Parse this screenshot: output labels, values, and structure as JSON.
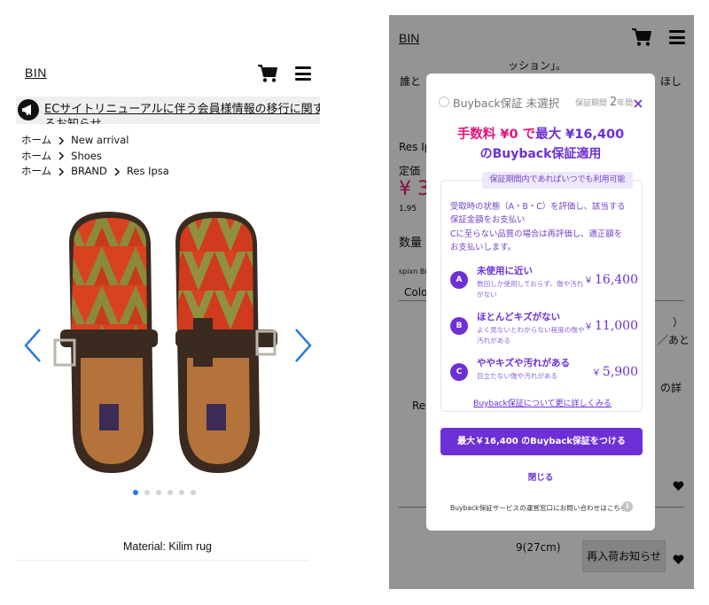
{
  "left": {
    "logo": "BIN",
    "notice_text": "ECサイトリニューアルに伴う会員様情報の移行に関す",
    "notice_text_line2": "るお知らせ",
    "breadcrumbs": [
      [
        "ホーム",
        "New arrival"
      ],
      [
        "ホーム",
        "Shoes"
      ],
      [
        "ホーム",
        "BRAND",
        "Res Ipsa"
      ]
    ],
    "carousel": {
      "total": 6,
      "active_index": 1
    },
    "material": "Material: Kilim rug"
  },
  "right": {
    "logo": "BIN",
    "bg_lines": [
      "ッション」。",
      "誰と",
      "ほし",
      "Res Ip",
      "定価",
      "¥ 3",
      "1,95",
      "数量",
      "spixn  Bu",
      "Colo",
      "）",
      "／あと",
      "の詳",
      "Rec",
      "9(27cm)"
    ],
    "restock_button": "再入荷お知らせ",
    "modal": {
      "head_title": "Buyback保証 未選択",
      "period_label": "保証期間",
      "period_value": "2",
      "period_unit": "年間",
      "headline_pink": "手数料 ¥0 で",
      "headline_purple": "最大 ¥16,400",
      "headline2": "のBuyback保証適用",
      "pill": "保証期間内であればいつでも利用可能",
      "desc": [
        "受取時の状態（A・B・C）を評価し、該当する",
        "保証金額をお支払い",
        "Cに至らない品質の場合は再評価し、適正額を",
        "お支払いします。"
      ],
      "grades": [
        {
          "letter": "A",
          "title": "未使用に近い",
          "sub": "数回しか使用しておらず、傷や汚れがない",
          "yen": "￥",
          "price": "16,400"
        },
        {
          "letter": "B",
          "title": "ほとんどキズがない",
          "sub": "よく見ないとわからない程度の傷や汚れがある",
          "yen": "￥",
          "price": "11,000"
        },
        {
          "letter": "C",
          "title": "ややキズや汚れがある",
          "sub": "目立たない傷や汚れがある",
          "yen": "￥",
          "price": "5,900"
        }
      ],
      "more_link": "Buyback保証について更に詳しくみる",
      "cta": "最大￥16,400 のBuyback保証をつける",
      "close_label": "閉じる",
      "footer": "Buyback保証サービスの運営窓口にお問い合わせはこちら",
      "info_icon": "i"
    }
  },
  "colors": {
    "accent_blue": "#2a7be4",
    "purple": "#6d2fd6",
    "pink": "#e4157a",
    "pill_bg": "#efe8fb"
  }
}
